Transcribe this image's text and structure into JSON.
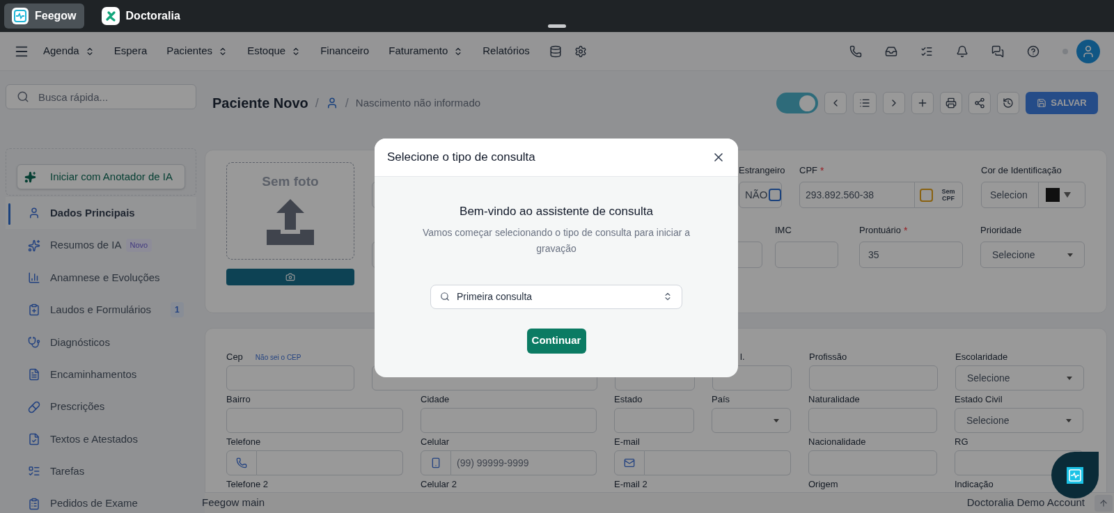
{
  "app_tabs": [
    {
      "label": "Feegow",
      "selected": true
    },
    {
      "label": "Doctoralia",
      "selected": false
    }
  ],
  "nav": {
    "items": [
      {
        "label": "Agenda",
        "dropdown": true
      },
      {
        "label": "Espera",
        "dropdown": false
      },
      {
        "label": "Pacientes",
        "dropdown": true
      },
      {
        "label": "Estoque",
        "dropdown": true
      },
      {
        "label": "Financeiro",
        "dropdown": false
      },
      {
        "label": "Faturamento",
        "dropdown": true
      },
      {
        "label": "Relatórios",
        "dropdown": false
      }
    ]
  },
  "quick_search": {
    "placeholder": "Busca rápida..."
  },
  "ai_button": "Iniciar com Anotador de IA",
  "sidebar": {
    "items": [
      {
        "label": "Dados Principais",
        "selected": true
      },
      {
        "label": "Resumos de IA",
        "selected": false,
        "badge": {
          "text": "Novo",
          "kind": "new"
        }
      },
      {
        "label": "Anamnese e Evoluções",
        "selected": false
      },
      {
        "label": "Laudos e Formulários",
        "selected": false,
        "badge": {
          "text": "1",
          "kind": "count"
        }
      },
      {
        "label": "Diagnósticos",
        "selected": false
      },
      {
        "label": "Encaminhamentos",
        "selected": false
      },
      {
        "label": "Prescrições",
        "selected": false
      },
      {
        "label": "Textos e Atestados",
        "selected": false
      },
      {
        "label": "Tarefas",
        "selected": false
      },
      {
        "label": "Pedidos de Exame",
        "selected": false
      }
    ]
  },
  "header": {
    "crumbs": [
      {
        "kind": "title",
        "text": "Paciente Novo"
      },
      {
        "kind": "sep",
        "text": "/"
      },
      {
        "kind": "user"
      },
      {
        "kind": "sep",
        "text": "/"
      },
      {
        "kind": "text",
        "text": "Nascimento não informado"
      }
    ],
    "toggle": {
      "on": true
    },
    "save_label": "SALVAR"
  },
  "photo": {
    "label": "Sem foto"
  },
  "form_main": {
    "fields": [
      {
        "kind": "text"
      },
      {
        "kind": "checkbox",
        "label": "Estrangeiro",
        "value": "NÃO",
        "checked": false
      },
      {
        "kind": "cpf",
        "label": "CPF",
        "mark": "*",
        "value": "293.892.560-38",
        "addon": "Sem CPF",
        "checked": false
      },
      {
        "kind": "color",
        "label": "Cor de Identificação",
        "value": "Selecion",
        "color": "#1c1c1c"
      },
      {
        "kind": "text"
      },
      {
        "kind": "text"
      },
      {
        "kind": "text",
        "label": "IMC"
      },
      {
        "kind": "text",
        "label": "Prontuário",
        "mark": "*",
        "value": "35"
      },
      {
        "kind": "select",
        "label": "Prioridade",
        "value": "Selecione"
      }
    ]
  },
  "form_address": {
    "rows": [
      [
        {
          "kind": "text",
          "label": "Cep",
          "link": "Não sei o CEP"
        },
        {
          "kind": "text"
        },
        {
          "kind": "text"
        },
        {
          "kind": "text",
          "label": "l."
        },
        {
          "kind": "text",
          "label": "Profissão"
        },
        {
          "kind": "select",
          "label": "Escolaridade",
          "value": "Selecione"
        }
      ],
      [
        {
          "kind": "text",
          "label": "Bairro"
        },
        {
          "kind": "text",
          "label": "Cidade"
        },
        {
          "kind": "text",
          "label": "Estado"
        },
        {
          "kind": "select",
          "label": "País"
        },
        {
          "kind": "text",
          "label": "Naturalidade"
        },
        {
          "kind": "select",
          "label": "Estado Civil",
          "value": "Selecione"
        }
      ],
      [
        {
          "kind": "addon",
          "label": "Telefone"
        },
        {
          "kind": "addon",
          "label": "Celular",
          "placeholder": "(99) 99999-9999"
        },
        {
          "kind": "addon",
          "label": "E-mail"
        },
        {
          "kind": "text",
          "label": "Nacionalidade"
        },
        {
          "kind": "text",
          "label": "RG"
        }
      ],
      [
        {
          "kind": "label",
          "label": "Telefone 2"
        },
        {
          "kind": "label",
          "label": "Celular 2"
        },
        {
          "kind": "label",
          "label": "E-mail 2"
        },
        {
          "kind": "label",
          "label": "Origem"
        },
        {
          "kind": "label",
          "label": "Indicação"
        }
      ]
    ]
  },
  "status_bar": {
    "left": "Feegow main",
    "right": "Doctoralia Demo Account"
  },
  "modal": {
    "title": "Selecione o tipo de consulta",
    "heading": "Bem-vindo ao assistente de consulta",
    "subtitle": "Vamos começar selecionando o tipo de consulta para iniciar a gravação",
    "select_value": "Primeira consulta",
    "button": "Continuar"
  }
}
